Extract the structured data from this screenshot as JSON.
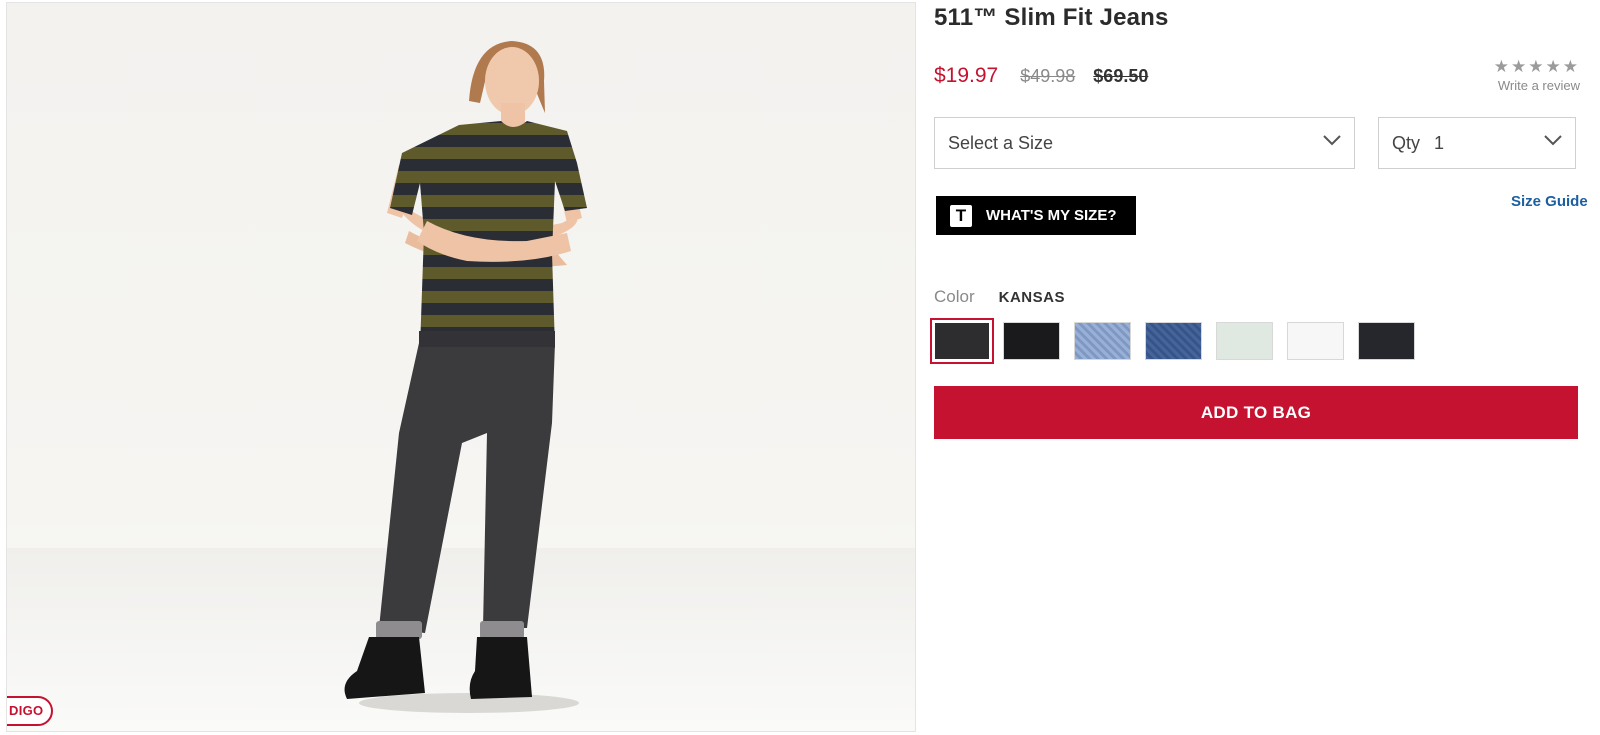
{
  "product": {
    "title": "511™ Slim Fit Jeans",
    "price_sale": "$19.97",
    "price_was": "$49.98",
    "price_original": "$69.50"
  },
  "rating": {
    "stars": "★★★★★",
    "stars_filled": 0,
    "write_review_label": "Write a review"
  },
  "size_select": {
    "selected_label": "Select a Size",
    "icon": "chevron-down-icon"
  },
  "qty_select": {
    "label": "Qty",
    "value": "1",
    "icon": "chevron-down-icon"
  },
  "fit_tool": {
    "icon_letter": "T",
    "label": "WHAT'S MY SIZE?"
  },
  "size_guide_label": "Size Guide",
  "color": {
    "label": "Color",
    "selected_name": "KANSAS",
    "swatches": [
      {
        "name": "kansas",
        "color": "#2d2c2e",
        "selected": true
      },
      {
        "name": "black",
        "color": "#1a191b"
      },
      {
        "name": "light-stonewash",
        "color": "#8fa7cf"
      },
      {
        "name": "medium-indigo",
        "color": "#3f5e94"
      },
      {
        "name": "pale-mint",
        "color": "#dfe9e2"
      },
      {
        "name": "white",
        "color": "#f7f7f7"
      },
      {
        "name": "dark-charcoal",
        "color": "#25272c"
      }
    ]
  },
  "add_to_bag_label": "ADD TO BAG",
  "image_badge_text": "DIGO",
  "colors": {
    "accent_red": "#c41230",
    "link_blue": "#1d5fa0"
  }
}
